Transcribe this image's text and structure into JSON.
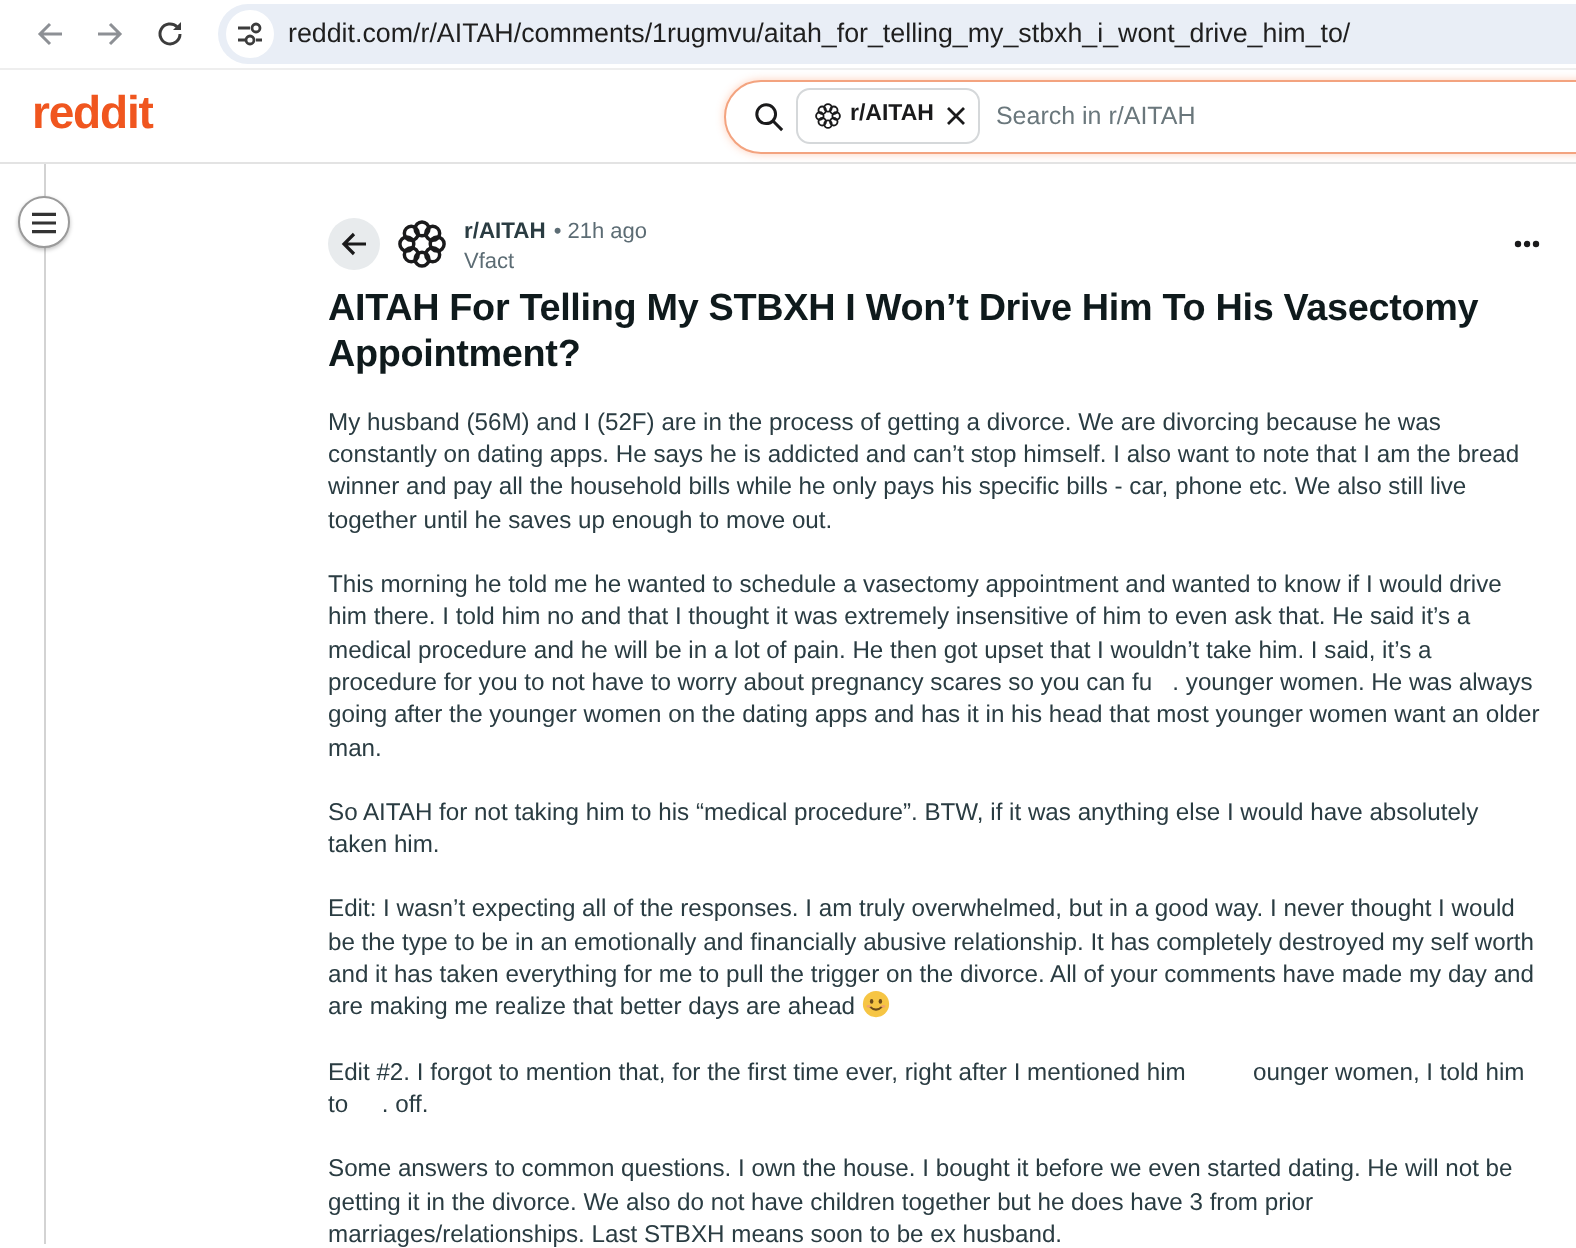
{
  "browser": {
    "url": "reddit.com/r/AITAH/comments/1rugmvu/aitah_for_telling_my_stbxh_i_wont_drive_him_to/"
  },
  "header": {
    "logo": "reddit",
    "search": {
      "chip": "r/AITAH",
      "placeholder": "Search in r/AITAH"
    }
  },
  "post": {
    "subreddit": "r/AITAH",
    "time": "• 21h ago",
    "author": "Vfact",
    "title": "AITAH For Telling My STBXH I Won’t Drive Him To His Vasectomy Appointment?",
    "paragraphs": [
      {
        "text": "My husband (56M) and I (52F) are in the process of getting a divorce. We are divorcing because he was constantly on dating apps. He says he is addicted and can’t stop himself. I also want to note that I am the bread winner and pay all the household bills while he only pays his specific bills - car, phone etc. We also still live together until he saves up enough to move out.",
        "emoji": false
      },
      {
        "text": "This morning he told me he wanted to schedule a vasectomy appointment and wanted to know if I would drive him there. I told him no and that I thought it was extremely insensitive of him to even ask that. He said it’s a medical procedure and he will be in a lot of pain. He then got upset that I wouldn’t take him. I said, it’s a procedure for you to not have to worry about pregnancy scares so you can fu   . younger women. He was always going after the younger women on the dating apps and has it in his head that most younger women want an older man.",
        "emoji": false
      },
      {
        "text": "So AITAH for not taking him to his “medical procedure”. BTW, if it was anything else I would have absolutely taken him.",
        "emoji": false
      },
      {
        "text": "Edit: I wasn’t expecting all of the responses. I am truly overwhelmed, but in a good way. I never thought I would be the type to be in an emotionally and financially abusive relationship. It has completely destroyed my self worth and it has taken everything for me to pull the trigger on the divorce. All of your comments have made my day and are making me realize that better days are ahead",
        "emoji": true
      },
      {
        "text": "Edit #2. I forgot to mention that, for the first time ever, right after I mentioned him          ounger women, I told him to     . off.",
        "emoji": false
      },
      {
        "text": "Some answers to common questions. I own the house. I bought it before we even started dating. He will not be getting it in the divorce. We also do not have children together but he does have 3 from prior marriages/relationships. Last STBXH means soon to be ex husband.",
        "emoji": false
      }
    ]
  }
}
